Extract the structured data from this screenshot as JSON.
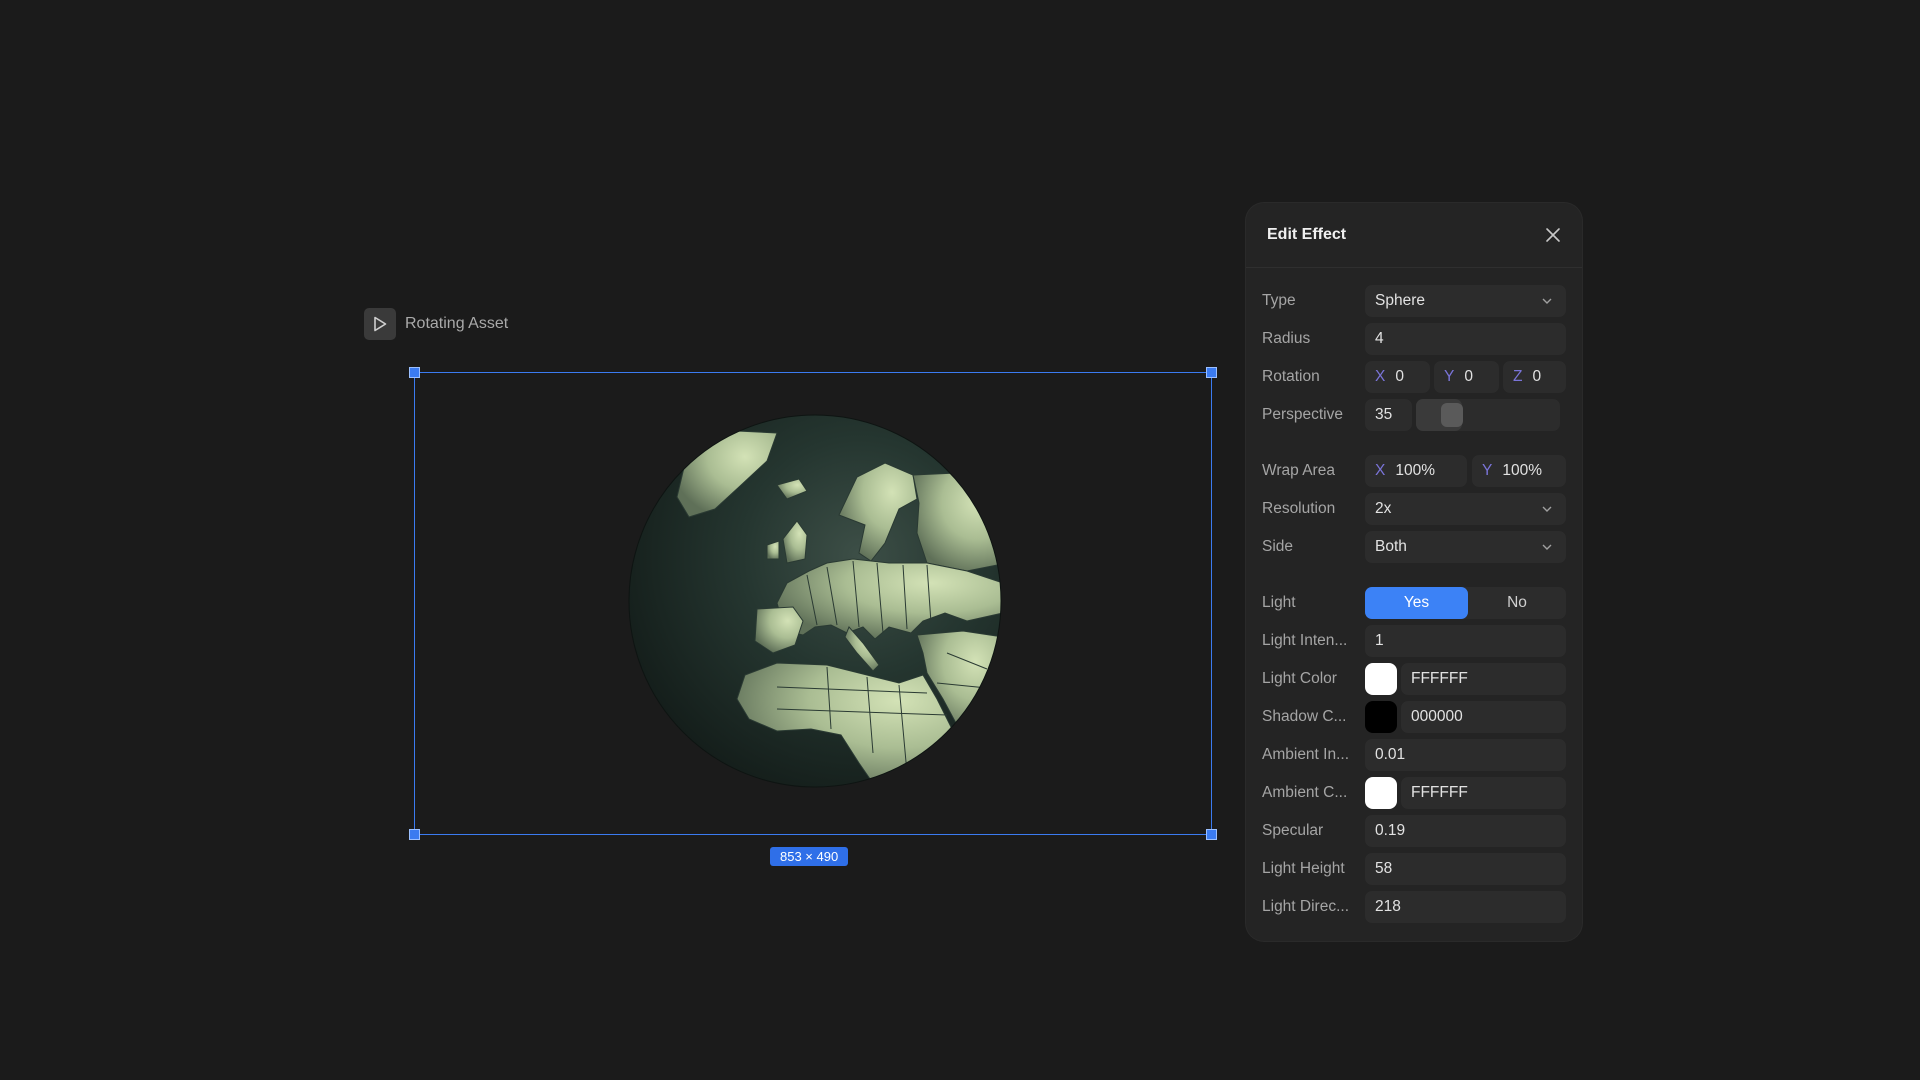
{
  "asset": {
    "name": "Rotating Asset",
    "size_label": "853 × 490"
  },
  "panel": {
    "title": "Edit Effect",
    "type": {
      "label": "Type",
      "value": "Sphere"
    },
    "radius": {
      "label": "Radius",
      "value": "4"
    },
    "rotation": {
      "label": "Rotation",
      "x_axis": "X",
      "x": "0",
      "y_axis": "Y",
      "y": "0",
      "z_axis": "Z",
      "z": "0"
    },
    "perspective": {
      "label": "Perspective",
      "value": "35"
    },
    "wrap_area": {
      "label": "Wrap Area",
      "x_axis": "X",
      "x": "100%",
      "y_axis": "Y",
      "y": "100%"
    },
    "resolution": {
      "label": "Resolution",
      "value": "2x"
    },
    "side": {
      "label": "Side",
      "value": "Both"
    },
    "light": {
      "label": "Light",
      "yes": "Yes",
      "no": "No",
      "selected": "Yes"
    },
    "light_intensity": {
      "label": "Light Inten...",
      "value": "1"
    },
    "light_color": {
      "label": "Light Color",
      "value": "FFFFFF",
      "swatch": "#ffffff"
    },
    "shadow_color": {
      "label": "Shadow C...",
      "value": "000000",
      "swatch": "#000000"
    },
    "ambient_intensity": {
      "label": "Ambient In...",
      "value": "0.01"
    },
    "ambient_color": {
      "label": "Ambient C...",
      "value": "FFFFFF",
      "swatch": "#ffffff"
    },
    "specular": {
      "label": "Specular",
      "value": "0.19"
    },
    "light_height": {
      "label": "Light Height",
      "value": "58"
    },
    "light_direction": {
      "label": "Light Direc...",
      "value": "218"
    }
  },
  "colors": {
    "accent": "#3c82f6",
    "background": "#1b1b1b",
    "panel": "#242424",
    "globe_land": "#b7c9a0",
    "globe_ocean": "#1e2c27"
  }
}
